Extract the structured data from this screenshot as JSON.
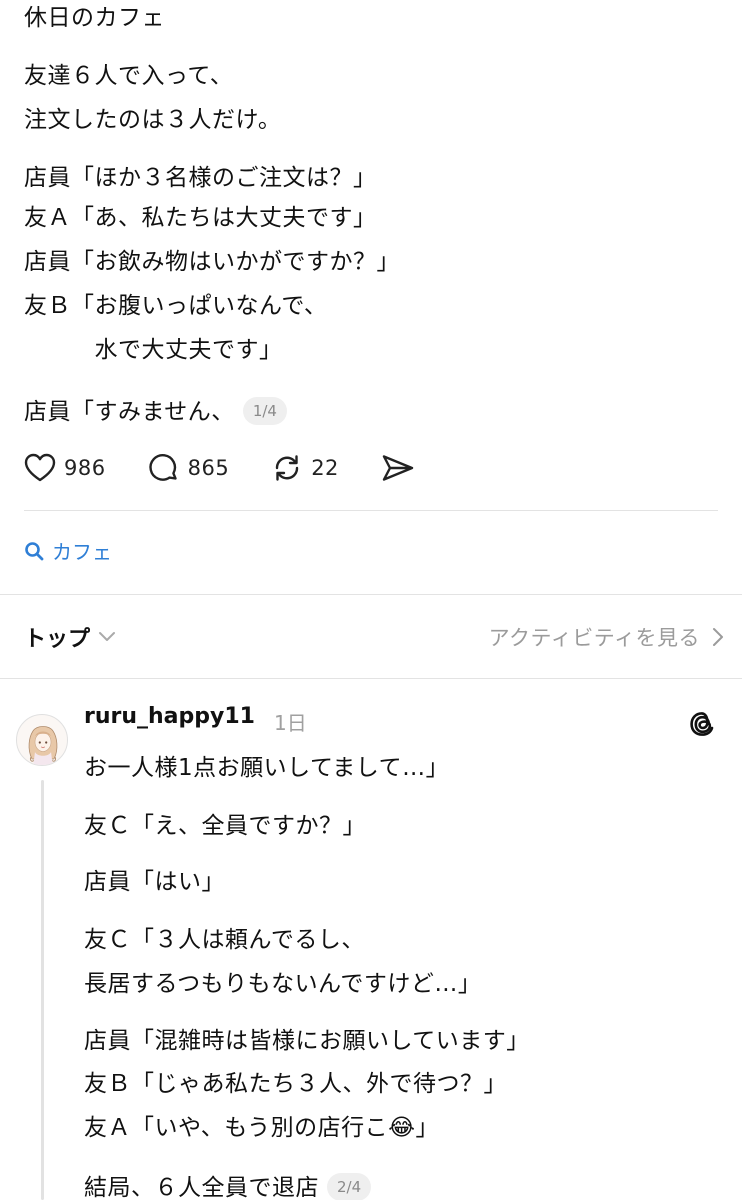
{
  "post": {
    "lines": [
      "休日のカフェ",
      "友達６人で入って、",
      "注文したのは３人だけ。",
      "店員「ほか３名様のご注文は？」",
      "友Ａ「あ、私たちは大丈夫です」",
      "店員「お飲み物はいかがですか？」",
      "友Ｂ「お腹いっぱいなんで、",
      "　　　水で大丈夫です」",
      "店員「すみません、"
    ],
    "page_badge": "1/4"
  },
  "actions": {
    "like_count": "986",
    "comment_count": "865",
    "repost_count": "22",
    "icons": [
      "heart-icon",
      "comment-icon",
      "repost-icon",
      "send-icon"
    ]
  },
  "topic": {
    "label": "カフェ",
    "icon": "search-icon"
  },
  "sort": {
    "label": "トップ",
    "activity_link": "アクティビティを見る"
  },
  "reply": {
    "username": "ruru_happy11",
    "time": "1日",
    "lines": [
      "お一人様1点お願いしてまして…」",
      "友Ｃ「え、全員ですか？」",
      "店員「はい」",
      "友Ｃ「３人は頼んでるし、",
      "長居するつもりもないんですけど…」",
      "店員「混雑時は皆様にお願いしています」",
      "友Ｂ「じゃあ私たち３人、外で待つ？」",
      "友Ａ「いや、もう別の店行こ😂」",
      "結局、６人全員で退店"
    ],
    "page_badge": "2/4"
  },
  "colors": {
    "accent": "#2f7fd6",
    "muted": "#9b9b9b",
    "badge_bg": "#efefef",
    "divider": "#e3e3e3"
  }
}
